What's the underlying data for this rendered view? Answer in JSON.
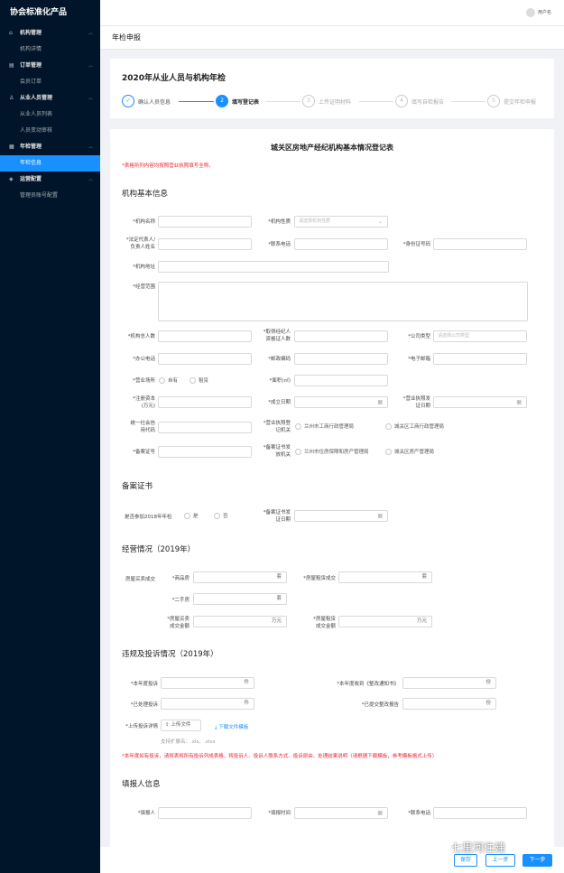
{
  "app": {
    "brand": "协会标准化产品",
    "user_name": "用户名"
  },
  "sidebar": {
    "groups": [
      {
        "label": "机构管理",
        "icon": "building-icon",
        "items": [
          "机构详情"
        ]
      },
      {
        "label": "订单管理",
        "icon": "cart-icon",
        "items": [
          "会员订单"
        ]
      },
      {
        "label": "从业人员管理",
        "icon": "people-icon",
        "items": [
          "从业人员列表",
          "人员变动审核"
        ]
      },
      {
        "label": "年检管理",
        "icon": "calendar-icon",
        "items": [
          "年检信息"
        ]
      },
      {
        "label": "运营配置",
        "icon": "shield-icon",
        "items": [
          "管理员账号配置"
        ]
      }
    ],
    "active_item": "年检信息"
  },
  "page": {
    "title": "年检申报"
  },
  "steps": {
    "title": "2020年从业人员与机构年检",
    "items": [
      {
        "num": "✓",
        "label": "确认人员信息",
        "state": "done"
      },
      {
        "num": "2",
        "label": "填写登记表",
        "state": "current"
      },
      {
        "num": "3",
        "label": "上传证明材料",
        "state": "pending"
      },
      {
        "num": "4",
        "label": "填写自检报告",
        "state": "pending"
      },
      {
        "num": "5",
        "label": "提交年检申报",
        "state": "pending"
      }
    ]
  },
  "form": {
    "title": "城关区房地产经纪机构基本情况登记表",
    "top_note": "*表格所列内容均按照营业执照填写全称。",
    "basic": {
      "heading": "机构基本信息",
      "name": "*机构名称",
      "nature": "*机构性质",
      "nature_ph": "请选择机构性质",
      "legal1": "*法定代表人/",
      "legal2": "负责人姓名",
      "phone": "*联系电话",
      "idno": "*身份证号码",
      "address": "*机构地址",
      "scope": "*经营范围",
      "total": "*机构总人数",
      "cert1": "*取得经纪人",
      "cert2": "资格证人数",
      "ctype": "*公司类型",
      "ctype_ph": "请选择公司类型",
      "office": "*办公电话",
      "zip": "*邮政编码",
      "email": "*电子邮箱",
      "venue": "*营业场所",
      "own": "自有",
      "rent": "租赁",
      "area": "*面积(㎡)",
      "cap1": "*注册资本",
      "cap2": "(万元)",
      "est": "*成立日期",
      "lic1": "*营业执照发",
      "lic2": "证日期",
      "credit1": "统一社会信",
      "credit2": "用代码",
      "issue1": "*营业执照登",
      "issue2": "记机关",
      "issue_a": "兰州市工商行政管理局",
      "issue_b": "城关区工商行政管理局",
      "filing": "*备案证号",
      "fissue1": "*备案证书发",
      "fissue2": "放机关",
      "fissue_a": "兰州市住房保障和房产管理局",
      "fissue_b": "城关区房产管理局"
    },
    "filing_cert": {
      "heading": "备案证书",
      "join": "是否参加2018年年检",
      "yes": "是",
      "no": "否",
      "date1": "*备案证书发",
      "date2": "证日期"
    },
    "business": {
      "heading": "经营情况（2019年）",
      "sale_deal": "房屋买卖成交",
      "new_house": "*商品房",
      "second_house": "*二手房",
      "unit_set": "套",
      "rent_deal": "*房屋租赁成交",
      "sale_amt1": "*房屋买卖",
      "sale_amt2": "成交金额",
      "rent_amt1": "*房屋租赁",
      "rent_amt2": "成交金额",
      "unit_wan": "万元"
    },
    "violation": {
      "heading": "违规及投诉情况（2019年）",
      "complaints": "*本年度投诉",
      "handled": "*已处理投诉",
      "unit_case": "件",
      "notices": "*本年度收到《整改通知书》",
      "reports": "*已提交整改报告",
      "unit_copy": "份",
      "upload_label": "*上传投诉详情",
      "upload_btn": "上传文件",
      "download": "下载文件模板",
      "ext_hint": "支持扩展名：.xls、.xlsx",
      "note": "*本年度如有投诉，请将表将所有投诉列成表格，将投诉人、投诉人联系方式、投诉原由、处理结果说明（请根据下载模板，参考模板格式上传）"
    },
    "reporter": {
      "heading": "填报人信息",
      "name": "*填报人",
      "time": "*填报时间",
      "phone": "*联系电话"
    }
  },
  "buttons": {
    "save": "保存",
    "prev": "上一步",
    "next": "下一步"
  },
  "watermark": "七里河住建",
  "colors": {
    "primary": "#1890ff",
    "sidebar": "#001529",
    "required": "#f5222d"
  }
}
